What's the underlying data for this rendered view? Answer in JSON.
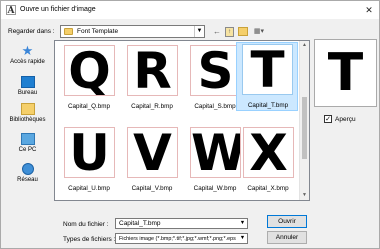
{
  "window": {
    "title": "Ouvre un fichier d'image",
    "app_icon_glyph": "A",
    "close_glyph": "✕"
  },
  "location": {
    "label": "Regarder dans :",
    "current_folder": "Font Template",
    "toolbar_icons": [
      "back-arrow-icon",
      "up-folder-icon",
      "new-folder-icon",
      "view-menu-icon"
    ]
  },
  "places": [
    {
      "label": "Accès rapide",
      "icon": "star-icon"
    },
    {
      "label": "Bureau",
      "icon": "desktop-icon"
    },
    {
      "label": "Bibliothèques",
      "icon": "libraries-icon"
    },
    {
      "label": "Ce PC",
      "icon": "computer-icon"
    },
    {
      "label": "Réseau",
      "icon": "network-icon"
    }
  ],
  "files": [
    {
      "name": "Capital_Q.bmp",
      "glyph": "Q"
    },
    {
      "name": "Capital_R.bmp",
      "glyph": "R"
    },
    {
      "name": "Capital_S.bmp",
      "glyph": "S"
    },
    {
      "name": "Capital_T.bmp",
      "glyph": "T",
      "selected": true
    },
    {
      "name": "Capital_U.bmp",
      "glyph": "U"
    },
    {
      "name": "Capital_V.bmp",
      "glyph": "V"
    },
    {
      "name": "Capital_W.bmp",
      "glyph": "W"
    },
    {
      "name": "Capital_X.bmp",
      "glyph": "X"
    }
  ],
  "preview": {
    "glyph": "T",
    "checkbox_label": "Aperçu",
    "checked": true
  },
  "form": {
    "filename_label": "Nom du fichier :",
    "filename_value": "Capital_T.bmp",
    "filetype_label": "Types de fichiers :",
    "filetype_value": "Fichiers image (*.bmp;*.tif;*.jpg;*.wmf;*.png;*.eps"
  },
  "buttons": {
    "open": "Ouvrir",
    "cancel": "Annuler"
  },
  "colors": {
    "selection_bg": "#cce8ff",
    "selection_border": "#99d1ff",
    "default_button_border": "#0078d7"
  }
}
